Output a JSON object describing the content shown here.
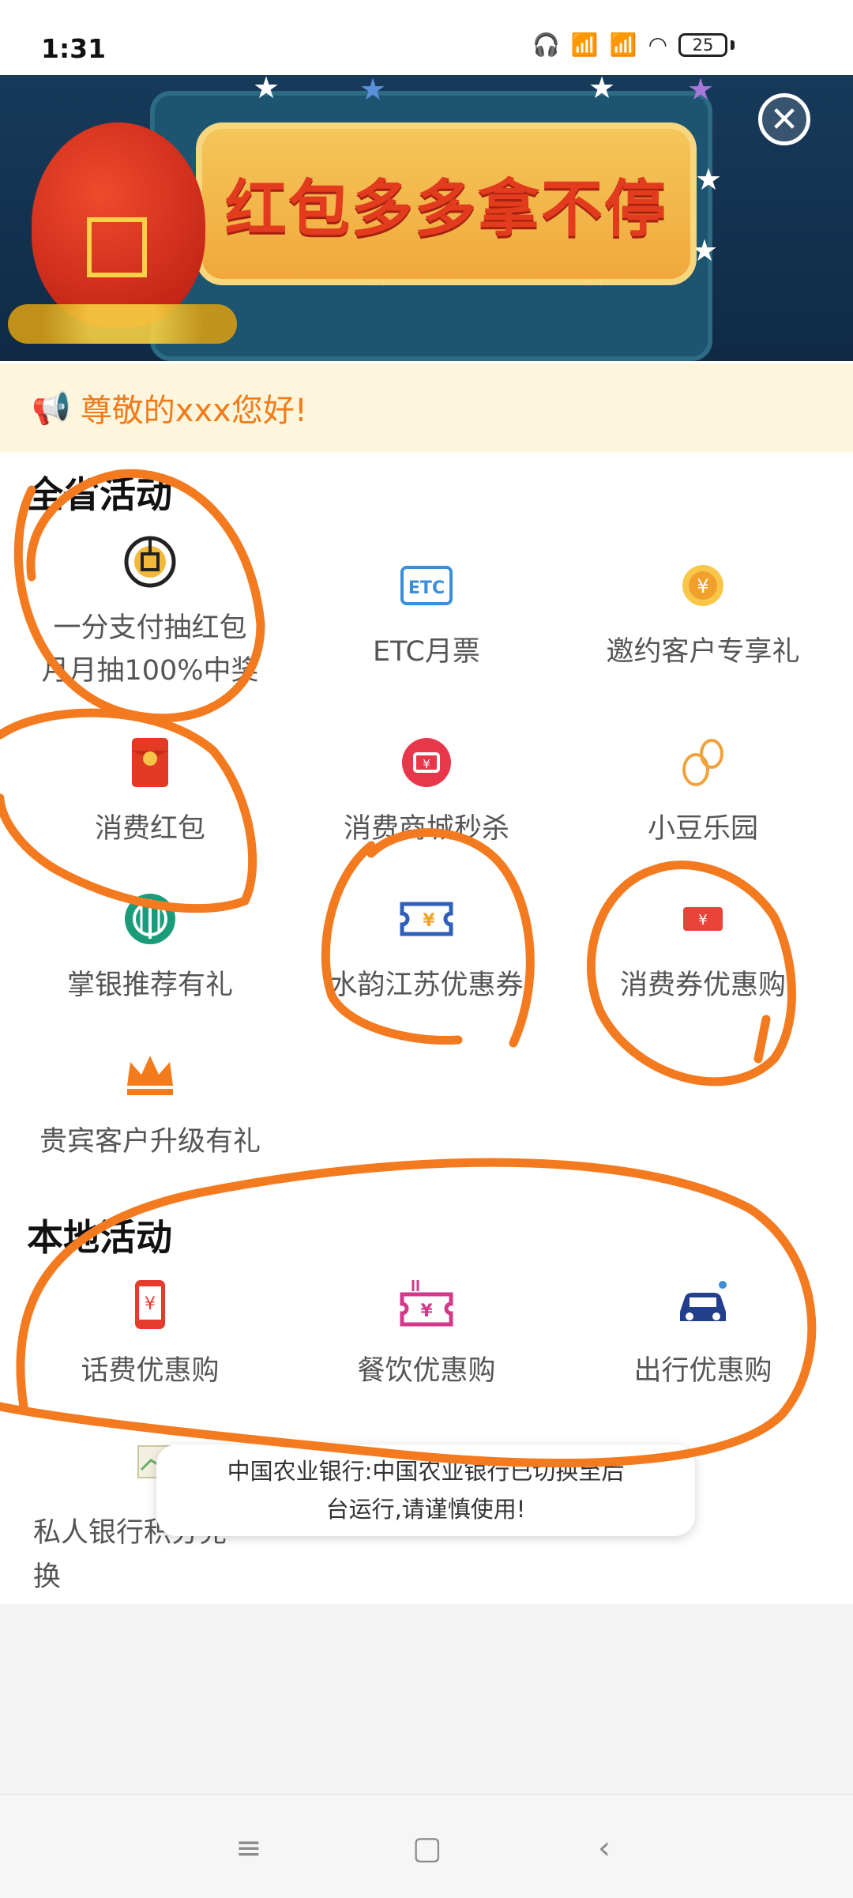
{
  "status_bar": {
    "time": "1:31",
    "battery": "25"
  },
  "banner": {
    "title": "红包多多拿不停"
  },
  "greeting": {
    "text": "尊敬的xxx您好!"
  },
  "provincial_section": {
    "title": "全省活动",
    "items": [
      {
        "icon": "coin-circle-icon",
        "label_line1": "一分支付抽红包",
        "label_line2": "月月抽100%中奖"
      },
      {
        "icon": "etc-icon",
        "label_line1": "ETC月票",
        "label_line2": ""
      },
      {
        "icon": "gift-yuan-icon",
        "label_line1": "邀约客户专享礼",
        "label_line2": ""
      },
      {
        "icon": "red-envelope-icon",
        "label_line1": "消费红包",
        "label_line2": ""
      },
      {
        "icon": "mall-flash-icon",
        "label_line1": "消费商城秒杀",
        "label_line2": ""
      },
      {
        "icon": "bean-icon",
        "label_line1": "小豆乐园",
        "label_line2": ""
      },
      {
        "icon": "bank-logo-icon",
        "label_line1": "掌银推荐有礼",
        "label_line2": ""
      },
      {
        "icon": "coupon-ticket-icon",
        "label_line1": "水韵江苏优惠券",
        "label_line2": ""
      },
      {
        "icon": "voucher-icon",
        "label_line1": "消费券优惠购",
        "label_line2": ""
      },
      {
        "icon": "crown-icon",
        "label_line1": "贵宾客户升级有礼",
        "label_line2": ""
      }
    ]
  },
  "local_section": {
    "title": "本地活动",
    "items": [
      {
        "icon": "phone-bill-icon",
        "label_line1": "话费优惠购",
        "label_line2": ""
      },
      {
        "icon": "dining-icon",
        "label_line1": "餐饮优惠购",
        "label_line2": ""
      },
      {
        "icon": "car-icon",
        "label_line1": "出行优惠购",
        "label_line2": ""
      },
      {
        "icon": "points-exchange-icon",
        "label_line1": "私人银行积分兑",
        "label_line2": "换"
      }
    ]
  },
  "toast": {
    "line1": "中国农业银行:中国农业银行已切换至后",
    "line2": "台运行,请谨慎使用!"
  },
  "colors": {
    "accent_orange": "#f07b1a",
    "greeting_bg": "#fdf6dd",
    "scribble": "#f37a1f"
  }
}
